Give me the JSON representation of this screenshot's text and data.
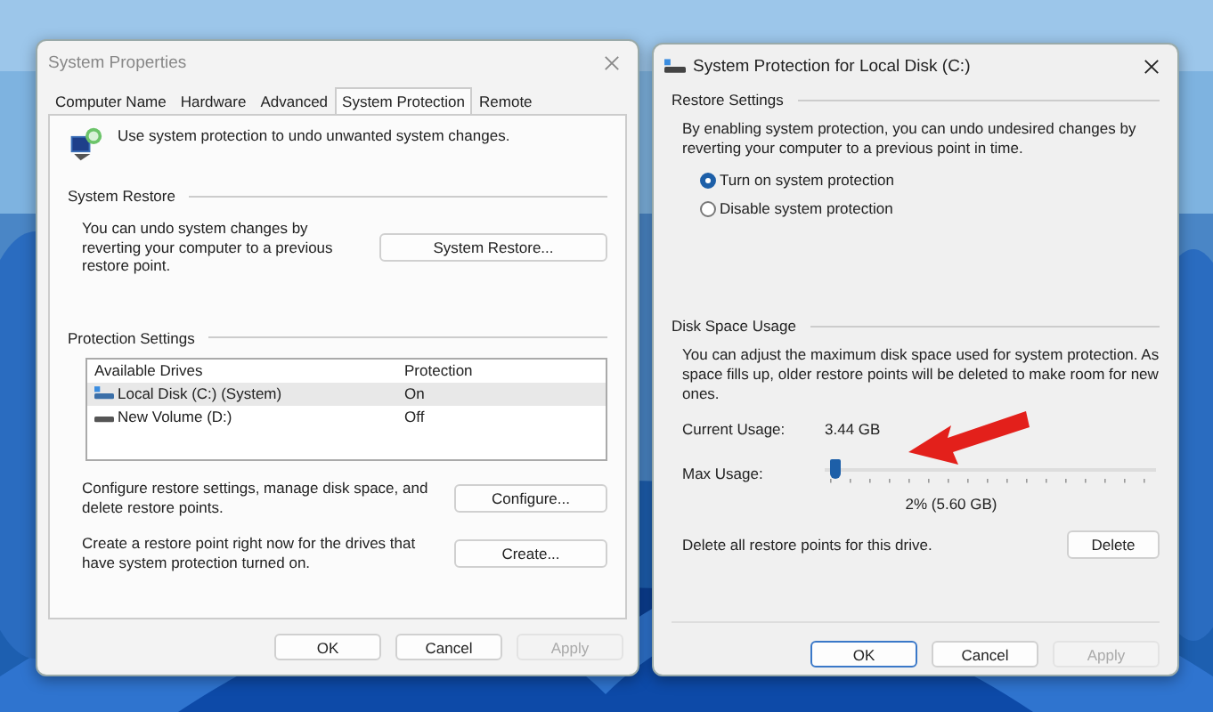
{
  "system_properties": {
    "title": "System Properties",
    "tabs": [
      {
        "label": "Computer Name",
        "selected": false
      },
      {
        "label": "Hardware",
        "selected": false
      },
      {
        "label": "Advanced",
        "selected": false
      },
      {
        "label": "System Protection",
        "selected": true
      },
      {
        "label": "Remote",
        "selected": false
      }
    ],
    "intro": "Use system protection to undo unwanted system changes.",
    "system_restore": {
      "heading": "System Restore",
      "text": "You can undo system changes by reverting your computer to a previous restore point.",
      "button": "System Restore..."
    },
    "protection_settings": {
      "heading": "Protection Settings",
      "columns": [
        "Available Drives",
        "Protection"
      ],
      "drives": [
        {
          "name": "Local Disk (C:) (System)",
          "protection": "On",
          "kind": "system",
          "selected": true
        },
        {
          "name": "New Volume (D:)",
          "protection": "Off",
          "kind": "volume",
          "selected": false
        }
      ],
      "actions": [
        {
          "text": "Configure restore settings, manage disk space, and delete restore points.",
          "button": "Configure..."
        },
        {
          "text": "Create a restore point right now for the drives that have system protection turned on.",
          "button": "Create..."
        }
      ]
    },
    "buttons": [
      {
        "label": "OK",
        "disabled": false,
        "default": false
      },
      {
        "label": "Cancel",
        "disabled": false,
        "default": false
      },
      {
        "label": "Apply",
        "disabled": true,
        "default": false
      }
    ]
  },
  "disk_protection": {
    "title": "System Protection for Local Disk (C:)",
    "restore_settings": {
      "heading": "Restore Settings",
      "text": "By enabling system protection, you can undo undesired changes by reverting your computer to a previous point in time.",
      "options": [
        {
          "label": "Turn on system protection",
          "selected": true
        },
        {
          "label": "Disable system protection",
          "selected": false
        }
      ]
    },
    "disk_space": {
      "heading": "Disk Space Usage",
      "text": "You can adjust the maximum disk space used for system protection. As space fills up, older restore points will be deleted to make room for new ones.",
      "current_label": "Current Usage:",
      "current_value": "3.44 GB",
      "max_label": "Max Usage:",
      "level": 0.02,
      "reading": "2% (5.60 GB)",
      "delete_text": "Delete all restore points for this drive.",
      "delete_button": "Delete"
    },
    "buttons": [
      {
        "label": "OK",
        "disabled": false,
        "default": true
      },
      {
        "label": "Cancel",
        "disabled": false,
        "default": false
      },
      {
        "label": "Apply",
        "disabled": true,
        "default": false
      }
    ]
  }
}
